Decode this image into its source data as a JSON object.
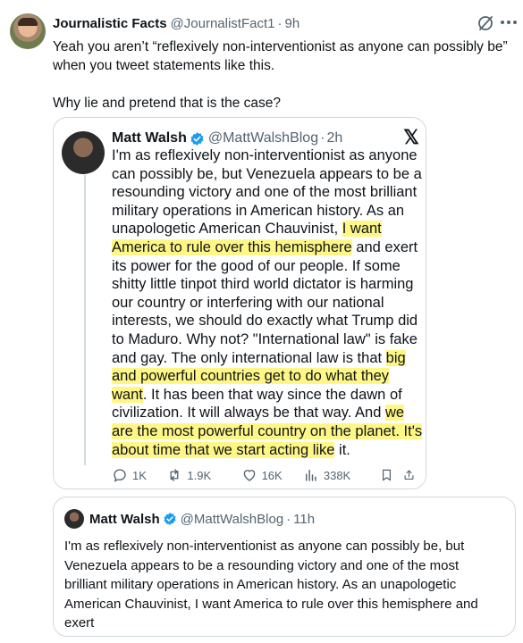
{
  "post": {
    "author_name": "Journalistic Facts",
    "author_handle": "@JournalistFact1",
    "separator": "·",
    "time": "9h",
    "text_line1": "Yeah you aren’t “reflexively non-interventionist as anyone can possibly be”",
    "text_line2": "when you tweet statements like this.",
    "text_line3": "Why lie and pretend that is the case?"
  },
  "screenshot": {
    "author_name": "Matt Walsh",
    "author_handle": "@MattWalshBlog",
    "separator": "·",
    "time": "2h",
    "x_logo": "𝕏",
    "lines": [
      [
        {
          "t": "I'm as reflexively non-interventionist as anyone"
        }
      ],
      [
        {
          "t": "can possibly be, but Venezuela appears to be a"
        }
      ],
      [
        {
          "t": "resounding victory and one of the most brilliant"
        }
      ],
      [
        {
          "t": "military operations in American history. As an"
        }
      ],
      [
        {
          "t": "unapologetic American Chauvinist, "
        },
        {
          "t": "I want",
          "hl": true
        }
      ],
      [
        {
          "t": "America to rule over this hemisphere",
          "hl": true
        },
        {
          "t": " and exert"
        }
      ],
      [
        {
          "t": "its power for the good of our people. If some"
        }
      ],
      [
        {
          "t": "shitty little tinpot third world dictator is harming"
        }
      ],
      [
        {
          "t": "our country or interfering with our national"
        }
      ],
      [
        {
          "t": "interests, we should do exactly what Trump did"
        }
      ],
      [
        {
          "t": "to Maduro. Why not? \"International law\" is fake"
        }
      ],
      [
        {
          "t": "and gay. The only international law is that "
        },
        {
          "t": "big",
          "hl": true
        }
      ],
      [
        {
          "t": "and powerful countries get to do what they",
          "hl": true
        }
      ],
      [
        {
          "t": "want",
          "hl": true
        },
        {
          "t": ". It has been that way since the dawn of"
        }
      ],
      [
        {
          "t": "civilization. It will always be that way. And "
        },
        {
          "t": "we",
          "hl": true
        }
      ],
      [
        {
          "t": "are the most powerful country on the planet. It's",
          "hl": true
        }
      ],
      [
        {
          "t": "about time that we start acting like",
          "hl": true
        },
        {
          "t": " it."
        }
      ]
    ],
    "actions": {
      "replies": "1K",
      "reposts": "1.9K",
      "likes": "16K",
      "views": "338K"
    }
  },
  "quote": {
    "author_name": "Matt Walsh",
    "author_handle": "@MattWalshBlog",
    "separator": "·",
    "time": "11h",
    "lines": [
      "I'm as reflexively non-interventionist as anyone can possibly be, but",
      "Venezuela appears to be a resounding victory and one of the most",
      "brilliant military operations in American history. As an unapologetic",
      "American Chauvinist, I want America to rule over this hemisphere and",
      "exert"
    ]
  },
  "colors": {
    "text": "#0f1419",
    "muted": "#536471",
    "border": "#cfd9de",
    "verified": "#1d9bf0",
    "highlight": "#fff45c"
  }
}
